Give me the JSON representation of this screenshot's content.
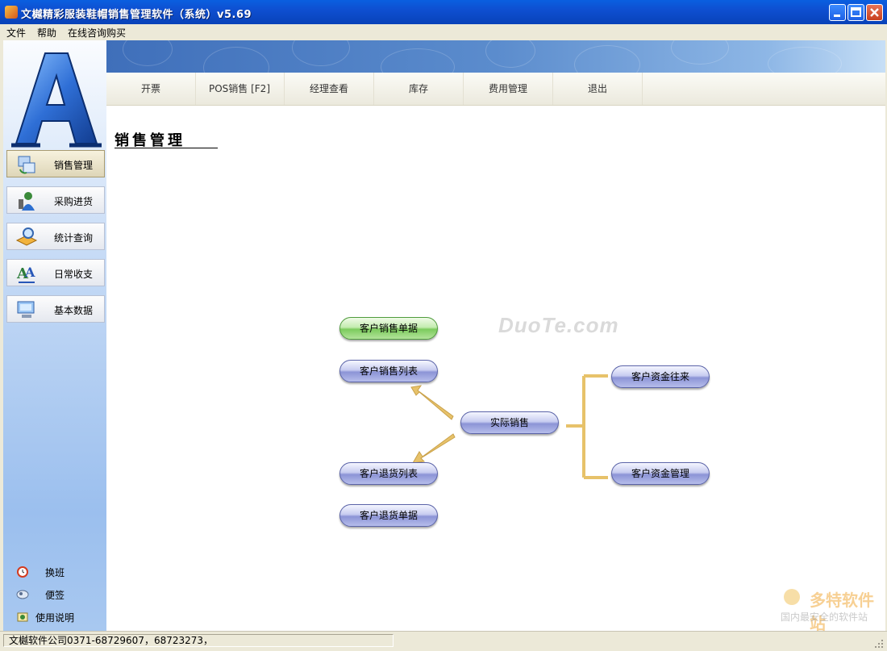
{
  "window": {
    "title": "文樾精彩服装鞋帽销售管理软件（系统）v5.69"
  },
  "menu": [
    "文件",
    "帮助",
    "在线咨询购买"
  ],
  "sidebar": {
    "nav": [
      {
        "label": "销售管理",
        "icon": "sales-icon"
      },
      {
        "label": "采购进货",
        "icon": "purchase-icon"
      },
      {
        "label": "统计查询",
        "icon": "statistics-icon"
      },
      {
        "label": "日常收支",
        "icon": "daily-finance-icon"
      },
      {
        "label": "基本数据",
        "icon": "computer-icon"
      }
    ],
    "tools": [
      {
        "label": "换班",
        "icon": "alarm-clock-icon"
      },
      {
        "label": "便签",
        "icon": "note-icon"
      },
      {
        "label": "使用说明",
        "icon": "help-icon"
      }
    ]
  },
  "tabs": [
    "开票",
    "POS销售 [F2]",
    "经理查看",
    "库存",
    "费用管理",
    "退出"
  ],
  "main": {
    "heading": "销售管理",
    "flow": {
      "customer_sales_doc": "客户销售单据",
      "customer_sales_list": "客户销售列表",
      "actual_sales": "实际销售",
      "customer_return_list": "客户退货列表",
      "customer_return_doc": "客户退货单据",
      "customer_funds_flow": "客户资金往来",
      "customer_funds_mgmt": "客户资金管理"
    }
  },
  "watermarks": {
    "duote": "DuoTe.com",
    "brand": "多特软件站",
    "slogan": "国内最安全的软件站"
  },
  "status": {
    "text": "文樾软件公司0371-68729607，68723273，"
  },
  "colors": {
    "titlebar": "#0e4fd1",
    "pill_blue": "#8c94d6",
    "pill_green": "#7ccb5d",
    "arrow": "#e7c26a"
  }
}
